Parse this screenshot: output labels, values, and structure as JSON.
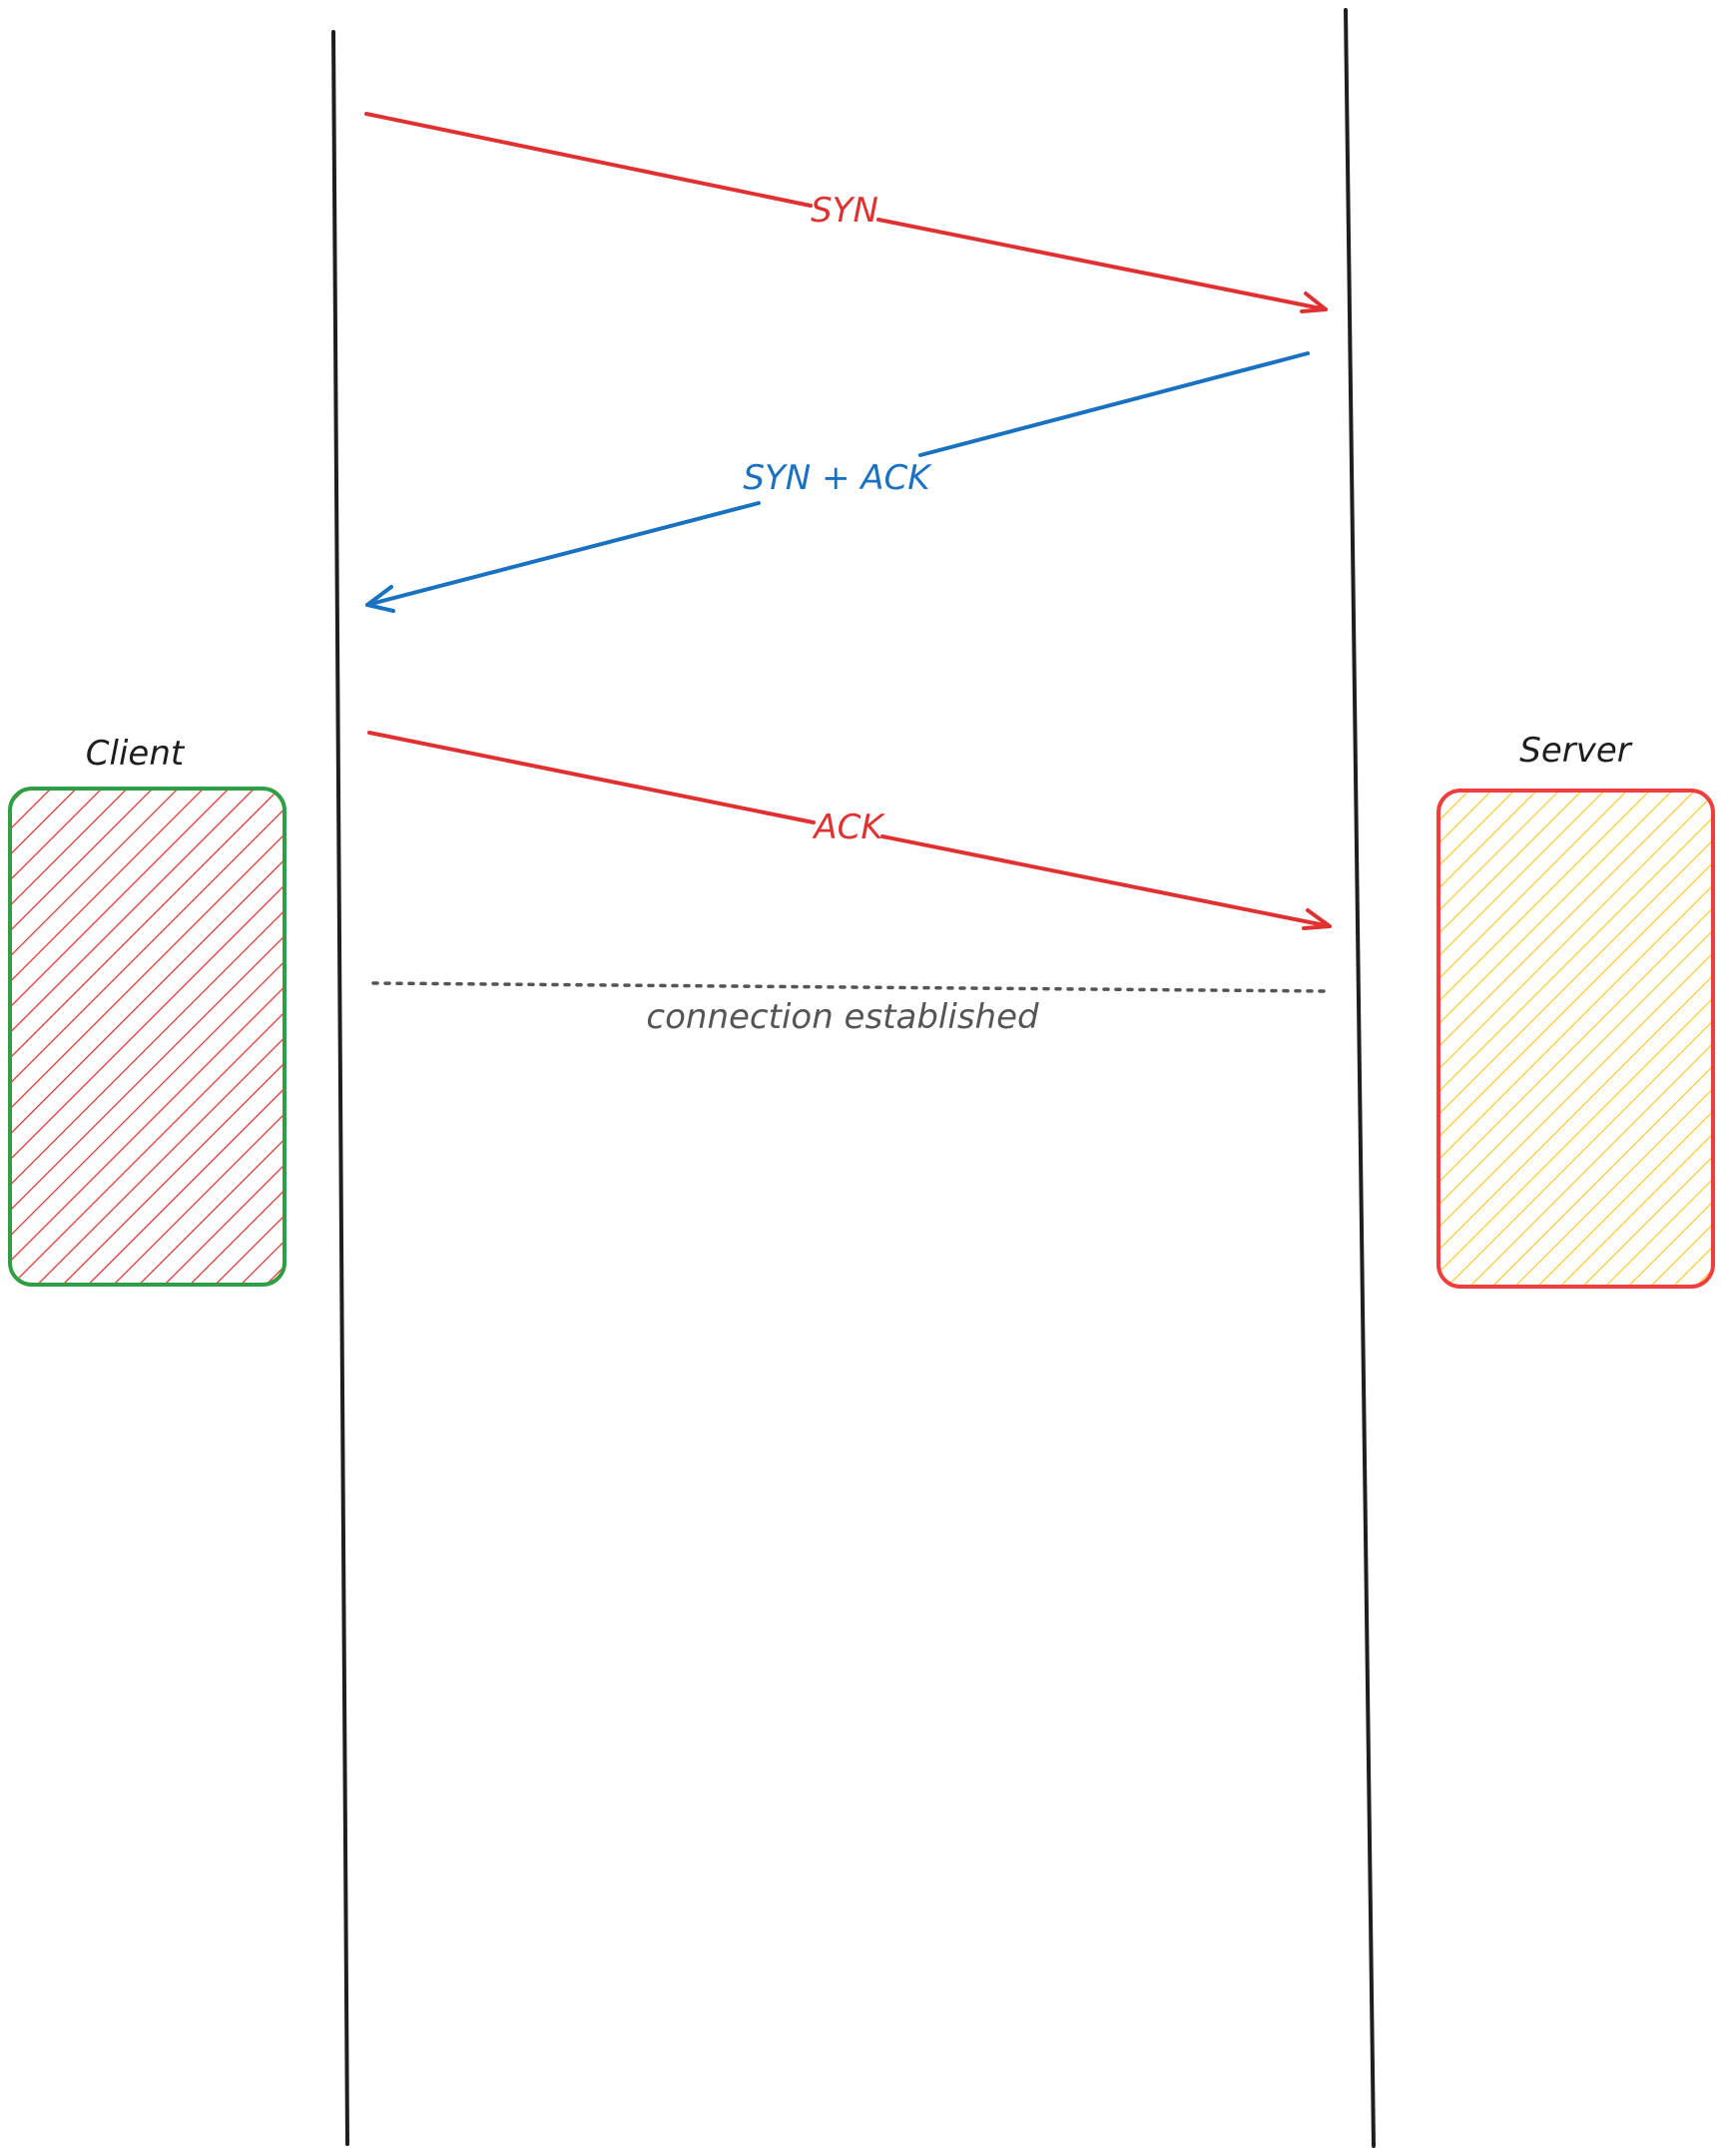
{
  "labels": {
    "client": "Client",
    "server": "Server",
    "syn": "SYN",
    "syn_ack": "SYN + ACK",
    "ack": "ACK",
    "connection": "connection established"
  },
  "colors": {
    "lifeline": "#1e1e1e",
    "red": "#e03131",
    "blue": "#1971c2",
    "green": "#2f9e44",
    "server_stroke": "#f03e3e",
    "server_hatch": "#fcc419",
    "dotted": "#555555",
    "connection_text": "#555555",
    "label_text": "#1e1e1e"
  }
}
